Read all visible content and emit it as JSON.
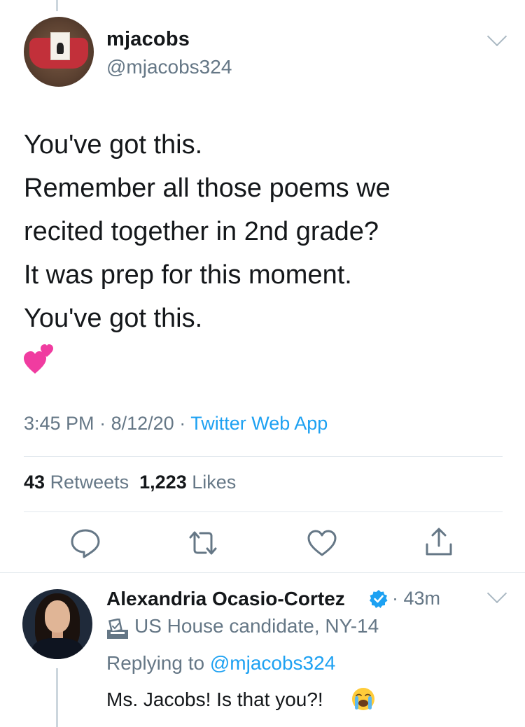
{
  "tweet": {
    "author_name": "mjacobs",
    "author_handle": "@mjacobs324",
    "text_lines": [
      "You've got this.",
      "Remember all those poems we",
      "recited together in 2nd grade?",
      "It was prep for this moment.",
      "You've got this."
    ],
    "emoji": "two-hearts-emoji",
    "time": "3:45 PM",
    "date": "8/12/20",
    "separator": "·",
    "source": "Twitter Web App",
    "retweets_count": "43",
    "retweets_label": "Retweets",
    "likes_count": "1,223",
    "likes_label": "Likes"
  },
  "actions": [
    {
      "name": "reply-icon"
    },
    {
      "name": "retweet-icon"
    },
    {
      "name": "like-icon"
    },
    {
      "name": "share-icon"
    }
  ],
  "reply": {
    "author_name": "Alexandria Ocasio-Cortez",
    "verified_icon": "verified-badge-icon",
    "time": "· 43m",
    "candidate_icon": "ballot-box-icon",
    "candidate_label": "US House candidate, NY-14",
    "replying_prefix": "Replying to",
    "replying_handle": "@mjacobs324",
    "text": "Ms. Jacobs! Is that you?!",
    "emoji": "loudly-crying-face-emoji"
  },
  "colors": {
    "link_blue": "#1da1f2",
    "secondary_gray": "#657786",
    "divider": "#e1e8ed"
  }
}
